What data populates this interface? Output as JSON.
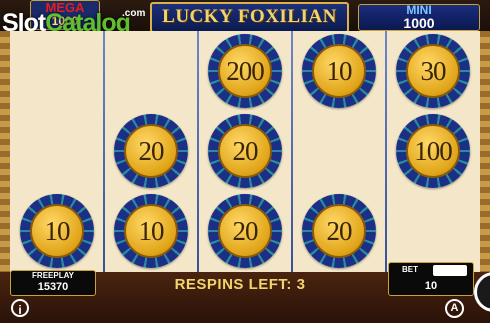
{
  "header": {
    "mega_label": "MEGA",
    "mega_value": "1000",
    "watermark_slot": "Slot",
    "watermark_catalog": "Catalog",
    "watermark_com": ".com",
    "title": "LUCKY FOXILIAN",
    "mini_label": "MINI",
    "mini_value": "1000"
  },
  "reels": {
    "columns": [
      [
        "",
        "",
        "10"
      ],
      [
        "",
        "20",
        "10"
      ],
      [
        "200",
        "20",
        "20"
      ],
      [
        "10",
        "",
        "20"
      ],
      [
        "30",
        "100",
        ""
      ]
    ]
  },
  "footer": {
    "freeplay_label": "FREEPLAY",
    "freeplay_value": "15370",
    "respins_text": "RESPINS LEFT: 3",
    "bet_label": "BET",
    "bet_value": "10",
    "info_icon": "i",
    "auto_icon": "A"
  },
  "colors": {
    "reel_background": "#f4e6c8",
    "coin_gold": "#e0a418",
    "coin_ring": "#1c2f86",
    "accent_gold": "#f3d36b"
  }
}
